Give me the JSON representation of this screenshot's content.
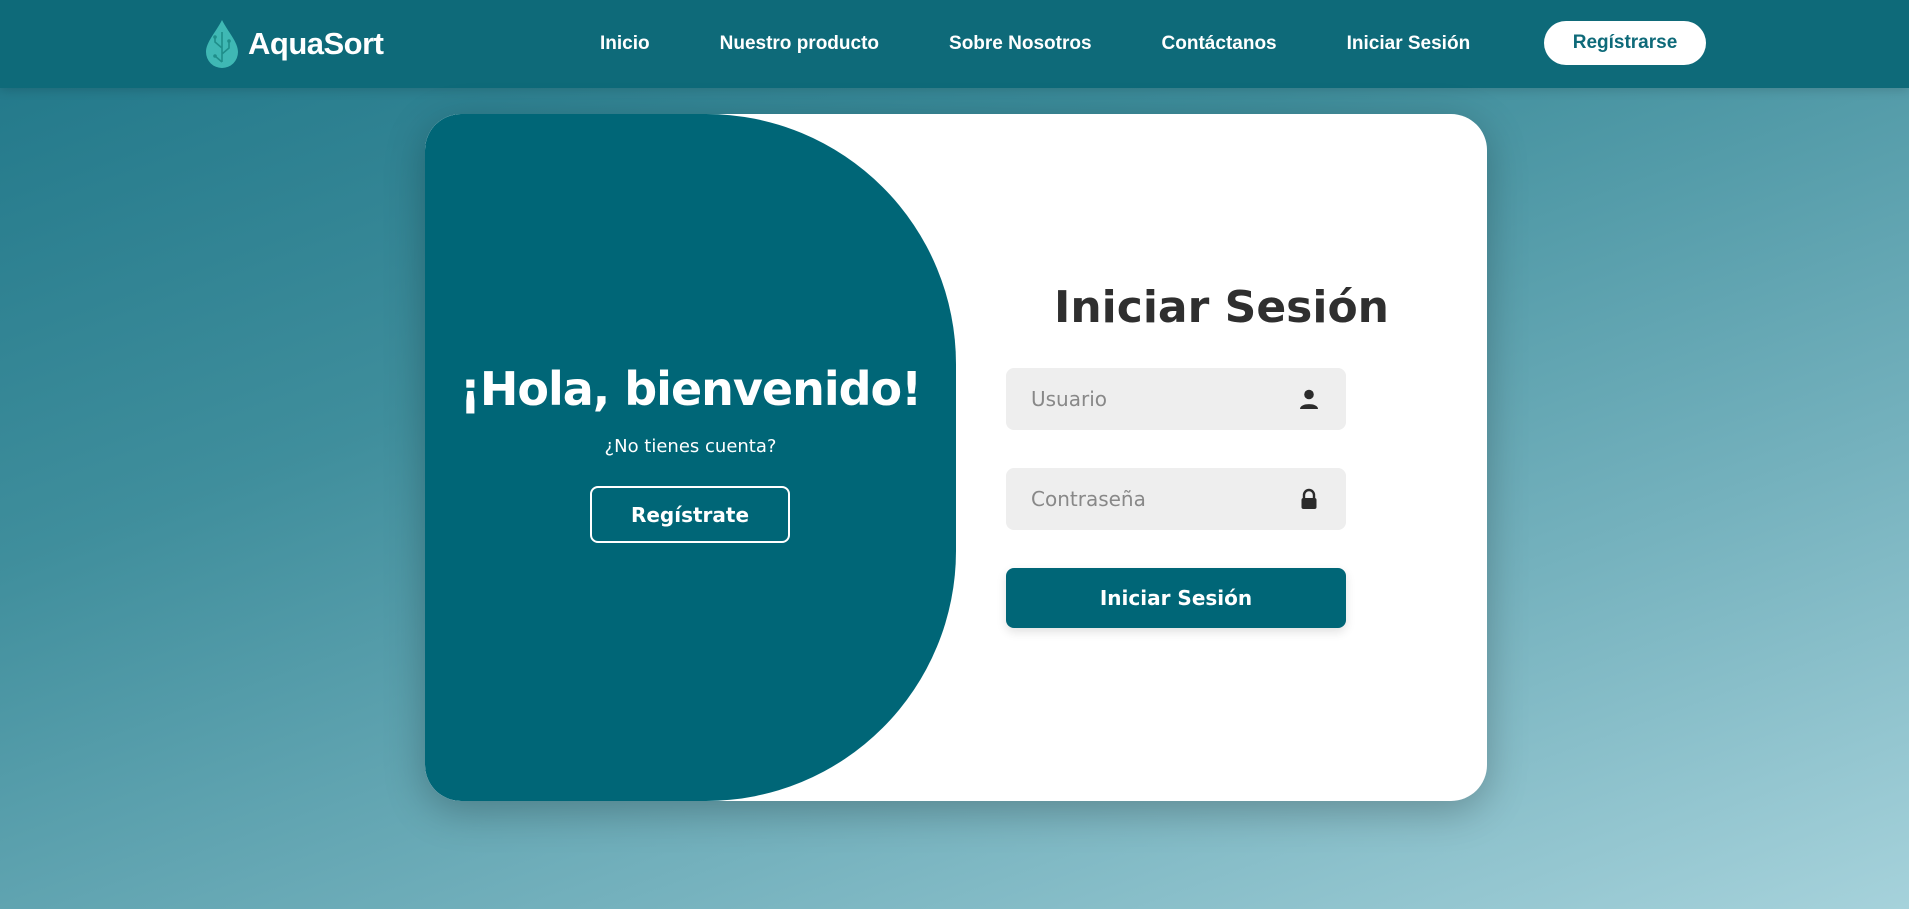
{
  "brand": {
    "name": "AquaSort",
    "icon": "water-drop-circuit-icon"
  },
  "nav": {
    "items": [
      {
        "label": "Inicio"
      },
      {
        "label": "Nuestro producto"
      },
      {
        "label": "Sobre Nosotros"
      },
      {
        "label": "Contáctanos"
      },
      {
        "label": "Iniciar Sesión"
      }
    ],
    "register_label": "Regístrarse"
  },
  "welcome": {
    "title": "¡Hola, bienvenido!",
    "subtitle": "¿No tienes cuenta?",
    "register_button": "Regístrate"
  },
  "login": {
    "title": "Iniciar Sesión",
    "username_placeholder": "Usuario",
    "username_icon": "user-icon",
    "password_placeholder": "Contraseña",
    "password_icon": "lock-icon",
    "submit_label": "Iniciar Sesión"
  },
  "colors": {
    "primary": "#006677",
    "navbar": "#0e6a79",
    "logo_drop": "#3fb8b4",
    "input_bg": "#eeeeee",
    "title_text": "#2f2f2f"
  }
}
